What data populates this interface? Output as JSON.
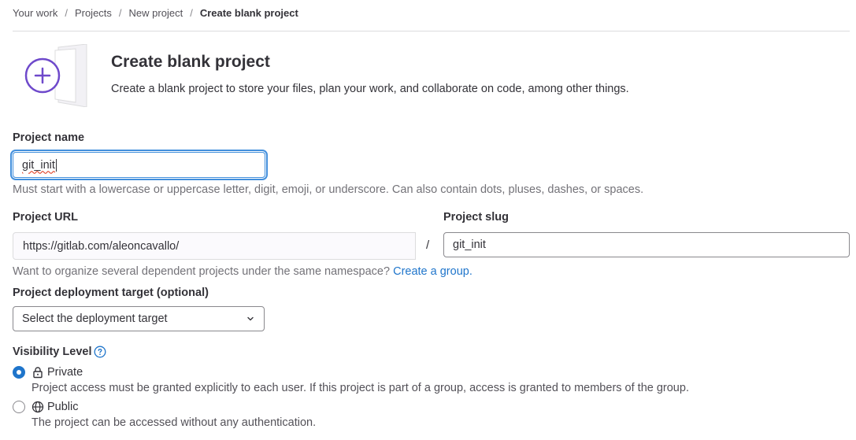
{
  "breadcrumb": {
    "items": [
      "Your work",
      "Projects",
      "New project"
    ],
    "current": "Create blank project",
    "separator": "/"
  },
  "header": {
    "title": "Create blank project",
    "description": "Create a blank project to store your files, plan your work, and collaborate on code, among other things."
  },
  "project_name": {
    "label": "Project name",
    "value": "git_init",
    "help": "Must start with a lowercase or uppercase letter, digit, emoji, or underscore. Can also contain dots, pluses, dashes, or spaces."
  },
  "project_url": {
    "label": "Project URL",
    "value": "https://gitlab.com/aleoncavallo/",
    "separator": "/"
  },
  "project_slug": {
    "label": "Project slug",
    "value": "git_init"
  },
  "namespace_help": {
    "text": "Want to organize several dependent projects under the same namespace? ",
    "link": "Create a group."
  },
  "deployment": {
    "label": "Project deployment target (optional)",
    "selected": "Select the deployment target"
  },
  "visibility": {
    "label": "Visibility Level",
    "options": [
      {
        "label": "Private",
        "icon": "lock-icon",
        "checked": true,
        "description": "Project access must be granted explicitly to each user. If this project is part of a group, access is granted to members of the group."
      },
      {
        "label": "Public",
        "icon": "earth-icon",
        "checked": false,
        "description": "The project can be accessed without any authentication."
      }
    ]
  },
  "colors": {
    "link": "#1f75cb",
    "focus_ring": "#428fdc",
    "radio_checked": "#1f75cb",
    "illustration_accent": "#6e49cb"
  }
}
